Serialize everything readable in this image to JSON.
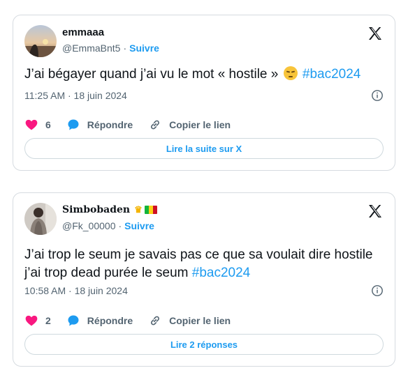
{
  "tweets": [
    {
      "display_name": "emmaaa",
      "handle": "@EmmaBnt5",
      "separator": "·",
      "follow_label": "Suivre",
      "text_main": "J’ai bégayer quand j’ai vu le mot « hostile » ",
      "emoji": "pensive-face-emoji",
      "hashtag": "#bac2024",
      "timestamp": "11:25 AM · 18 juin 2024",
      "likes": "6",
      "reply_label": "Répondre",
      "copy_label": "Copier le lien",
      "button_label": "Lire la suite sur X"
    },
    {
      "display_name": "Simbobaden",
      "handle": "@Fk_00000",
      "separator": "·",
      "follow_label": "Suivre",
      "text_line1": "J’ai trop le seum je savais pas ce que sa voulait dire hostile",
      "text_line2": "j’ai trop dead purée le seum ",
      "hashtag": "#bac2024",
      "timestamp": "10:58 AM · 18 juin 2024",
      "likes": "2",
      "reply_label": "Répondre",
      "copy_label": "Copier le lien",
      "button_label": "Lire 2 réponses",
      "badges": [
        "crown-emoji",
        "mali-flag-emoji"
      ]
    }
  ],
  "colors": {
    "link_blue": "#1d9bf0",
    "heart_pink": "#f91880",
    "muted_gray": "#536471",
    "text_dark": "#0f1419",
    "border": "#d6dbe0"
  },
  "icons": [
    "x-logo-icon",
    "heart-icon",
    "reply-bubble-icon",
    "link-icon",
    "info-icon"
  ]
}
